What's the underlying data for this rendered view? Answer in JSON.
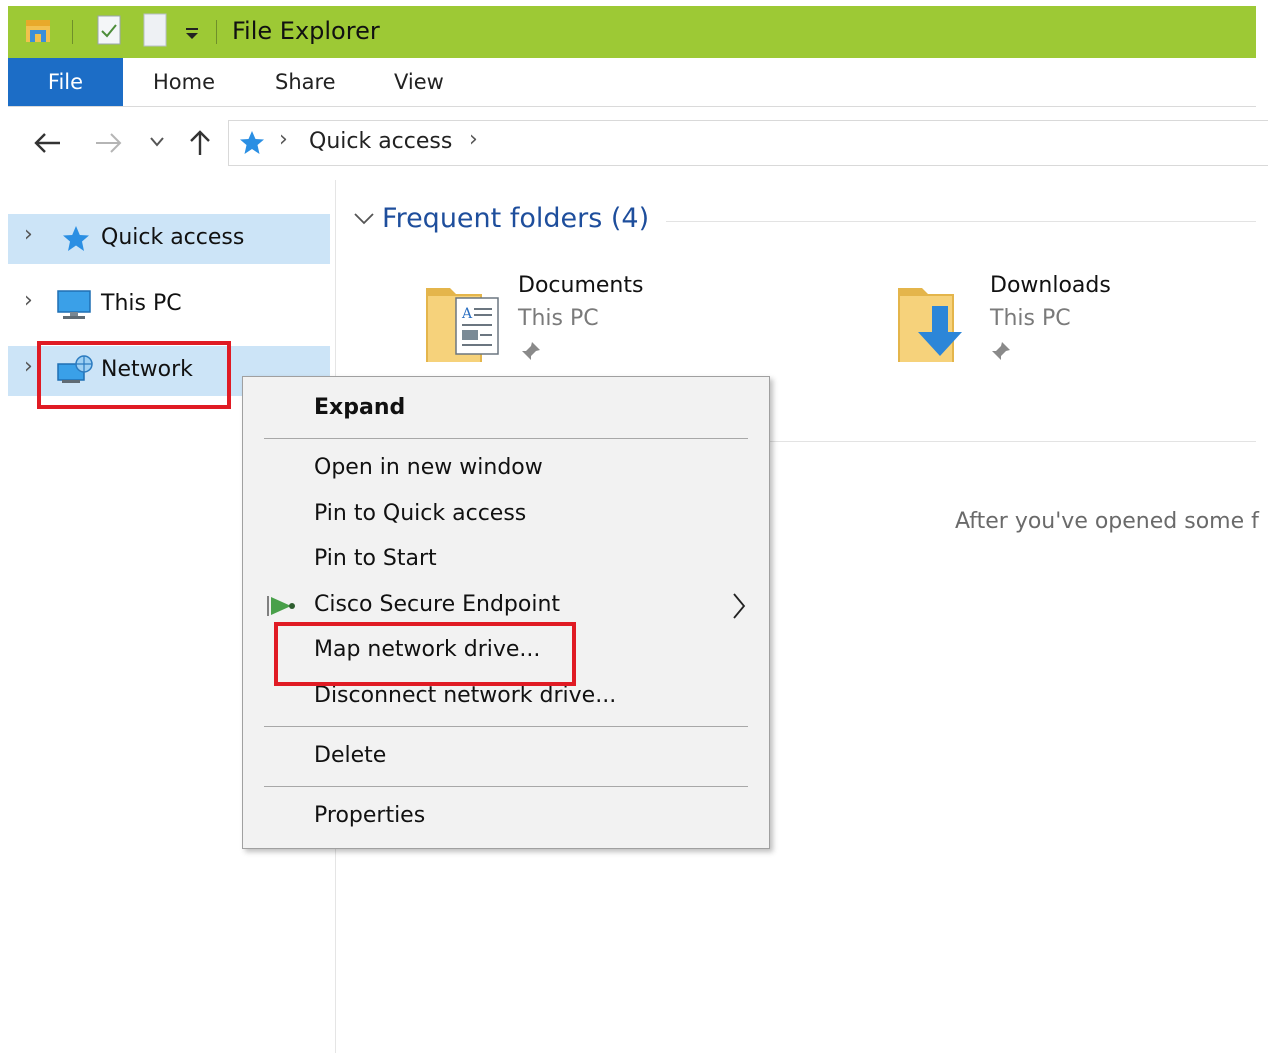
{
  "window": {
    "title": "File Explorer"
  },
  "ribbon": {
    "tabs": [
      "File",
      "Home",
      "Share",
      "View"
    ]
  },
  "address": {
    "crumbs": [
      "Quick access"
    ]
  },
  "nav_pane": {
    "items": [
      {
        "label": "Quick access",
        "icon": "star-icon",
        "selected": true
      },
      {
        "label": "This PC",
        "icon": "computer-icon",
        "selected": false
      },
      {
        "label": "Network",
        "icon": "network-icon",
        "selected": true
      }
    ]
  },
  "content": {
    "section_title": "Frequent folders (4)",
    "folders": [
      {
        "name": "Documents",
        "location": "This PC",
        "icon": "documents-folder-icon"
      },
      {
        "name": "Downloads",
        "location": "This PC",
        "icon": "downloads-folder-icon"
      }
    ],
    "empty_message": "After you've opened some f"
  },
  "context_menu": {
    "items": [
      "Expand",
      "Open in new window",
      "Pin to Quick access",
      "Pin to Start",
      "Cisco Secure Endpoint",
      "Map network drive...",
      "Disconnect network drive...",
      "Delete",
      "Properties"
    ]
  },
  "colors": {
    "title_bar": "#9dc935",
    "file_tab": "#1c6dc6",
    "selection": "#cce4f7",
    "highlight": "#e01b24",
    "section_title": "#1e4e9c"
  }
}
